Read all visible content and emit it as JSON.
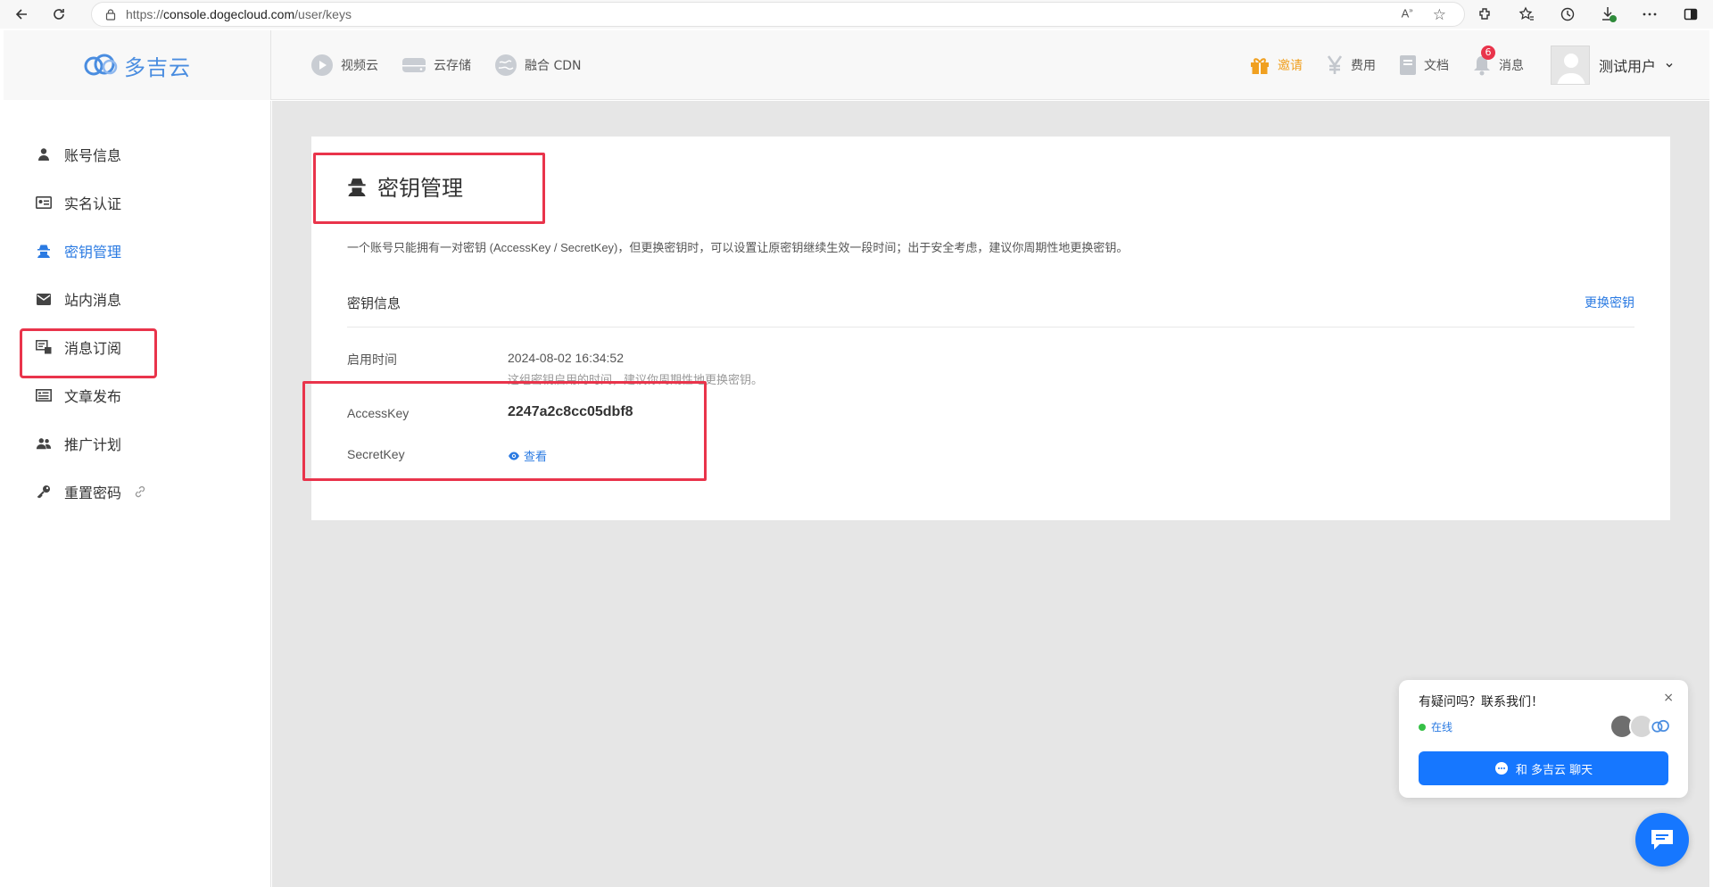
{
  "browser": {
    "url_proto": "https://",
    "url_host": "console.dogecloud.com",
    "url_path": "/user/keys",
    "back_icon": "arrow-left-icon",
    "refresh_icon": "refresh-icon"
  },
  "header": {
    "logo_text": "多吉云",
    "top_nav": [
      {
        "label": "视频云",
        "icon": "play-icon"
      },
      {
        "label": "云存储",
        "icon": "storage-icon"
      },
      {
        "label": "融合 CDN",
        "icon": "globe-icon"
      }
    ],
    "right_nav": {
      "invite": "邀请",
      "billing": "费用",
      "docs": "文档",
      "messages": "消息",
      "messages_badge": "6",
      "user_name": "测试用户"
    },
    "invite_color": "#f0a020"
  },
  "sidebar": {
    "items": [
      {
        "label": "账号信息",
        "icon": "user-icon"
      },
      {
        "label": "实名认证",
        "icon": "id-card-icon"
      },
      {
        "label": "密钥管理",
        "icon": "spy-icon",
        "active": true
      },
      {
        "label": "站内消息",
        "icon": "envelope-icon"
      },
      {
        "label": "消息订阅",
        "icon": "subscribe-icon"
      },
      {
        "label": "文章发布",
        "icon": "article-icon"
      },
      {
        "label": "推广计划",
        "icon": "users-icon"
      },
      {
        "label": "重置密码",
        "icon": "key-icon"
      }
    ],
    "active_color": "#2a7ae2"
  },
  "main": {
    "title": "密钥管理",
    "description": "一个账号只能拥有一对密钥 (AccessKey / SecretKey)，但更换密钥时，可以设置让原密钥继续生效一段时间；出于安全考虑，建议你周期性地更换密钥。",
    "section_title": "密钥信息",
    "change_key": "更换密钥",
    "enabled_label": "启用时间",
    "enabled_value": "2024-08-02 16:34:52",
    "enabled_hint": "这组密钥启用的时间，建议你周期性地更换密钥。",
    "access_key_label": "AccessKey",
    "access_key_value": "2247a2c8cc05dbf8",
    "secret_key_label": "SecretKey",
    "view_label": "查看",
    "highlight_color": "#e9344b"
  },
  "chat": {
    "question": "有疑问吗？联系我们！",
    "status": "在线",
    "button": "和 多吉云 聊天",
    "close": "×",
    "button_color": "#1677ff"
  }
}
